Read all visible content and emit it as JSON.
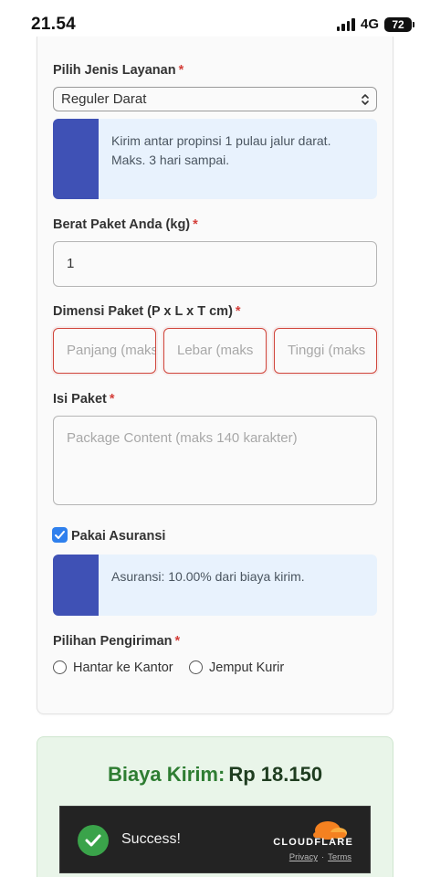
{
  "status_bar": {
    "time": "21.54",
    "network": "4G",
    "battery": "72"
  },
  "form": {
    "service_label": "Pilih Jenis Layanan",
    "required_mark": "*",
    "service_selected": "Reguler Darat",
    "service_info": "Kirim antar propinsi 1 pulau jalur darat. Maks. 3 hari sampai.",
    "weight_label": "Berat Paket Anda (kg)",
    "weight_value": "1",
    "dimension_label": "Dimensi Paket (P x L x T cm)",
    "length_placeholder": "Panjang (maks",
    "width_placeholder": "Lebar (maks",
    "height_placeholder": "Tinggi (maks",
    "contents_label": "Isi Paket",
    "contents_placeholder": "Package Content (maks 140 karakter)",
    "insurance_label": "Pakai Asuransi",
    "insurance_checked": true,
    "insurance_info": "Asuransi: 10.00% dari biaya kirim.",
    "delivery_label": "Pilihan Pengiriman",
    "delivery_options": [
      "Hantar ke Kantor",
      "Jemput Kurir"
    ]
  },
  "cost": {
    "label": "Biaya Kirim:",
    "amount": "Rp 18.150"
  },
  "captcha": {
    "status": "Success!",
    "brand": "CLOUDFLARE",
    "privacy": "Privacy",
    "separator": "·",
    "terms": "Terms"
  },
  "colors": {
    "accent": "#3f51b5",
    "info_bg": "#e8f2fd",
    "success_green": "#2e7d32",
    "error_red": "#d0463c",
    "checkbox_blue": "#2f80ed",
    "cloudflare_orange": "#f48120"
  }
}
